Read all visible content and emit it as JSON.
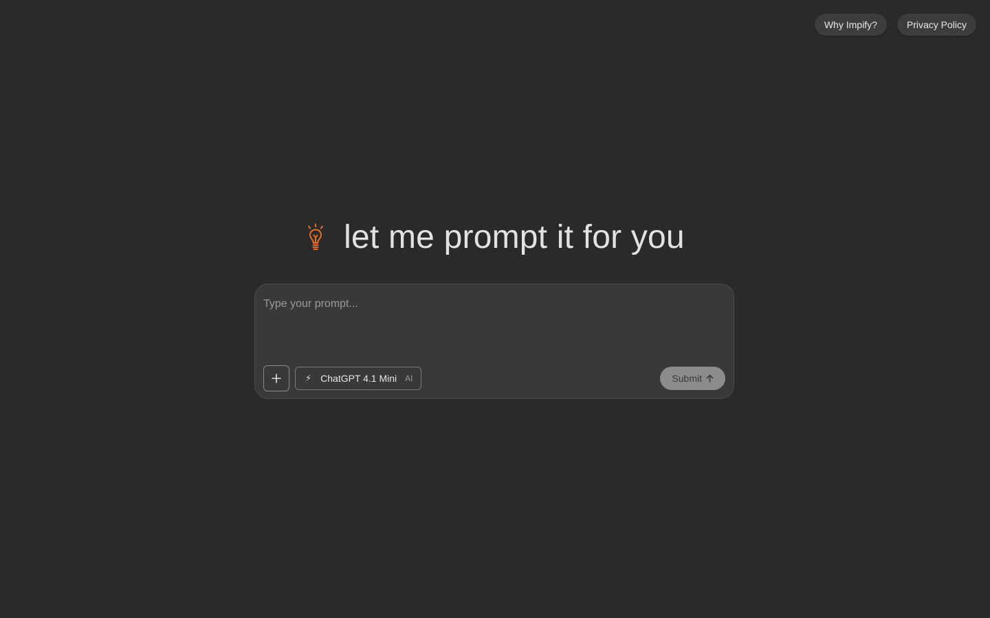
{
  "nav": {
    "why_label": "Why Impify?",
    "privacy_label": "Privacy Policy"
  },
  "hero": {
    "title": "let me prompt it for you",
    "icon": "lightbulb-icon",
    "icon_color": "#e46f23"
  },
  "prompt": {
    "placeholder": "Type your prompt...",
    "value": ""
  },
  "toolbar": {
    "add_icon": "plus-icon",
    "model": {
      "icon": "lightning-bolt-icon",
      "bolt_glyph": "⚡",
      "name": "ChatGPT 4.1 Mini",
      "tag": "AI"
    },
    "submit_label": "Submit",
    "submit_icon": "arrow-up-icon"
  }
}
